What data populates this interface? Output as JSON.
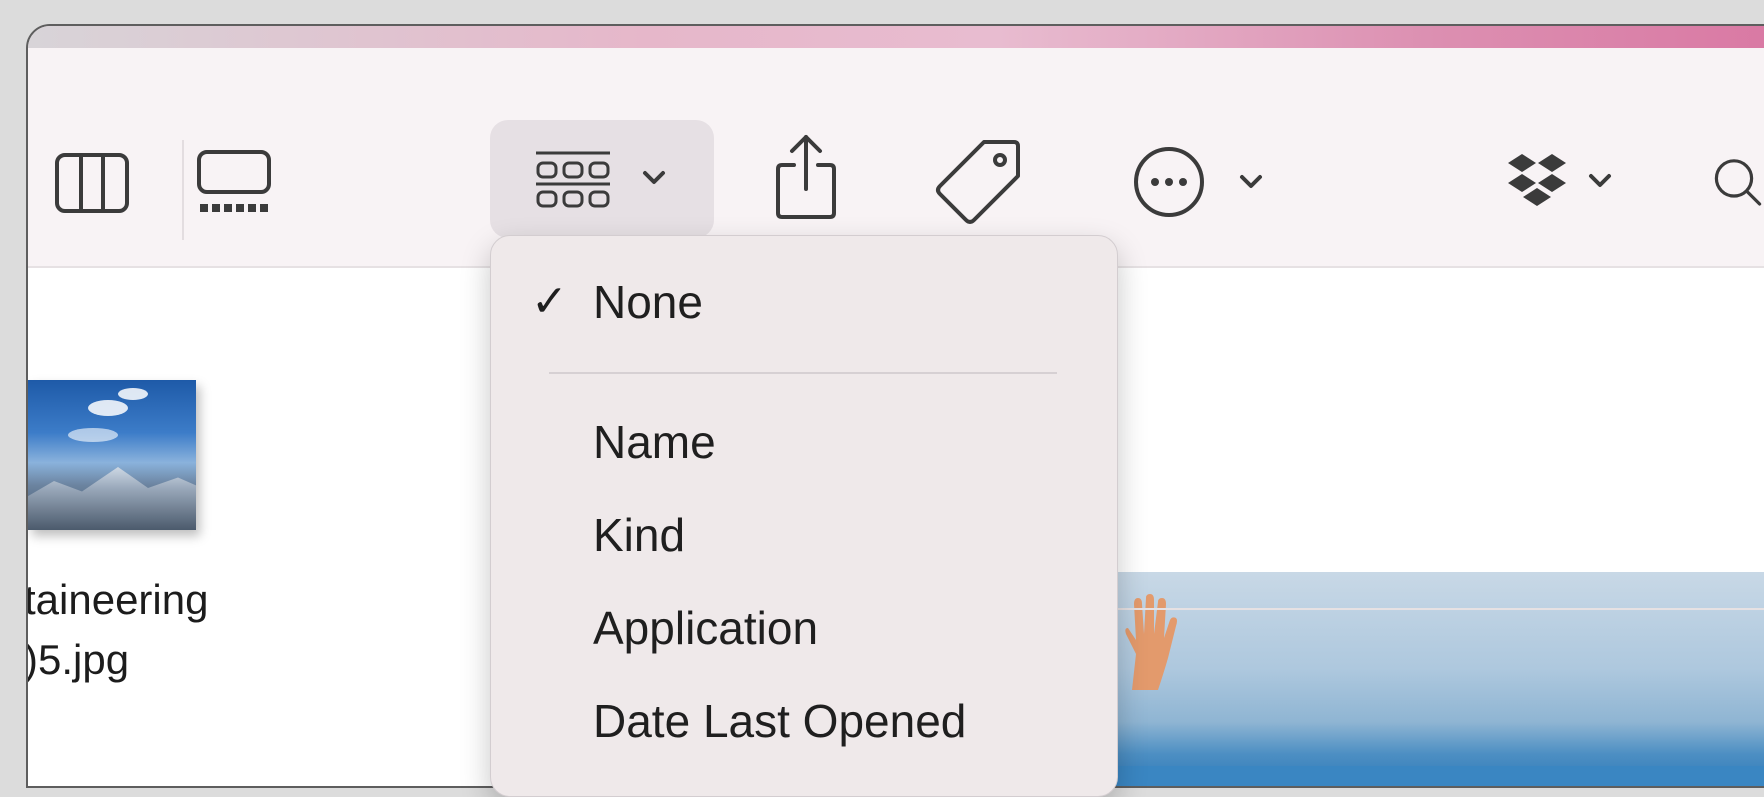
{
  "toolbar": {
    "icons": [
      "columns-view-icon",
      "gallery-view-icon",
      "group-by-icon",
      "chevron-down-icon",
      "share-icon",
      "tag-icon",
      "more-actions-icon",
      "chevron-down-icon",
      "dropbox-icon",
      "chevron-down-icon",
      "search-icon"
    ]
  },
  "content": {
    "file_name_line1": "taineering",
    "file_name_line2": ")5.jpg"
  },
  "group_menu": {
    "checkmark": "✓",
    "selected": "None",
    "items": [
      "Name",
      "Kind",
      "Application",
      "Date Last Opened"
    ]
  },
  "colors": {
    "menu_bg": "#efe9ea",
    "toolbar_bg": "#f8f3f5",
    "active_button_bg": "#e6e0e4"
  }
}
